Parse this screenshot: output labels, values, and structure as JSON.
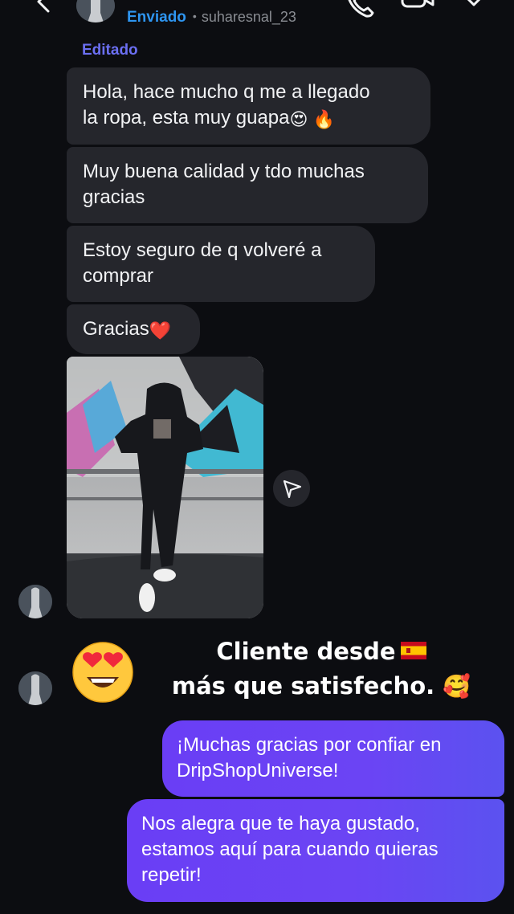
{
  "header": {
    "status": "Enviado",
    "separator": "•",
    "username": "suharesnal_23"
  },
  "conversation": {
    "edited_label": "Editado",
    "incoming": [
      {
        "lines": [
          "Hola, hace mucho q me a llegado",
          "la ropa, esta muy guapa"
        ],
        "emoji": "😍 🔥"
      },
      {
        "lines": [
          "Muy buena calidad y tdo muchas",
          "gracias"
        ]
      },
      {
        "lines": [
          "Estoy seguro de q volveré a",
          "comprar"
        ]
      },
      {
        "lines": [
          "Gracias"
        ],
        "emoji": "❤️"
      }
    ],
    "photo": {
      "subject": "person in black hoodie tracksuit in front of graffiti wall"
    },
    "sticker": {
      "emoji": "😍",
      "caption_line1": "Cliente desde",
      "caption_line2": "más que satisfecho.",
      "caption_emoji": "🥰",
      "flag_colors": {
        "red": "#c60b1e",
        "yellow": "#ffc400"
      }
    },
    "outgoing": [
      {
        "lines": [
          "¡Muchas gracias por confiar en",
          "DripShopUniverse!"
        ]
      },
      {
        "lines": [
          "Nos alegra que te haya gustado,",
          "estamos aquí para cuando quieras",
          "repetir!"
        ]
      }
    ]
  },
  "colors": {
    "background": "#0c0d11",
    "incoming_bubble": "#25262c",
    "outgoing_bubble": "#6a3ef5",
    "sent_status": "#2e95f0",
    "edited": "#6b6ff2"
  },
  "icons": [
    "back-icon",
    "call-icon",
    "video-call-icon",
    "tag-icon",
    "share-icon"
  ]
}
